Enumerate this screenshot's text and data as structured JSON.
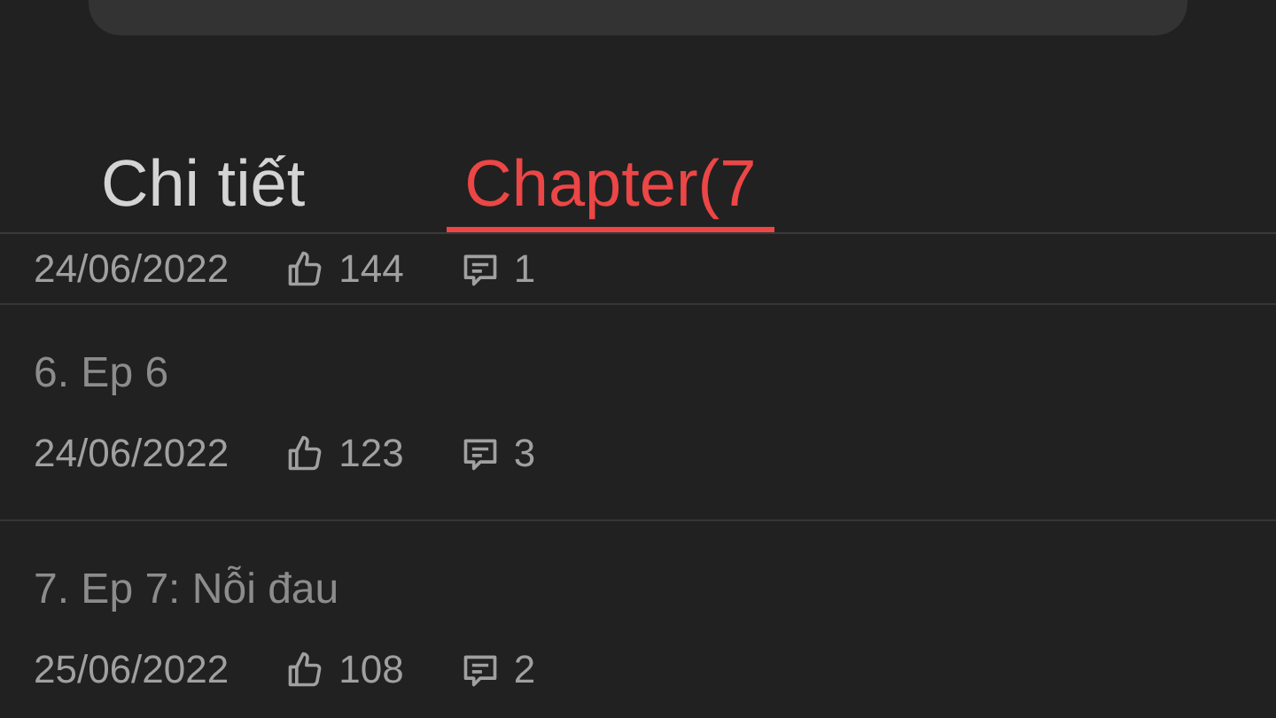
{
  "tabs": [
    {
      "label": "Chi tiết",
      "selected": false
    },
    {
      "label": "Chapter(7",
      "selected": true
    }
  ],
  "chapters": [
    {
      "date": "24/06/2022",
      "likes": "144",
      "comments": "1"
    },
    {
      "title": "6. Ep 6",
      "date": "24/06/2022",
      "likes": "123",
      "comments": "3"
    },
    {
      "title": "7. Ep 7: Nỗi đau",
      "date": "25/06/2022",
      "likes": "108",
      "comments": "2"
    }
  ]
}
